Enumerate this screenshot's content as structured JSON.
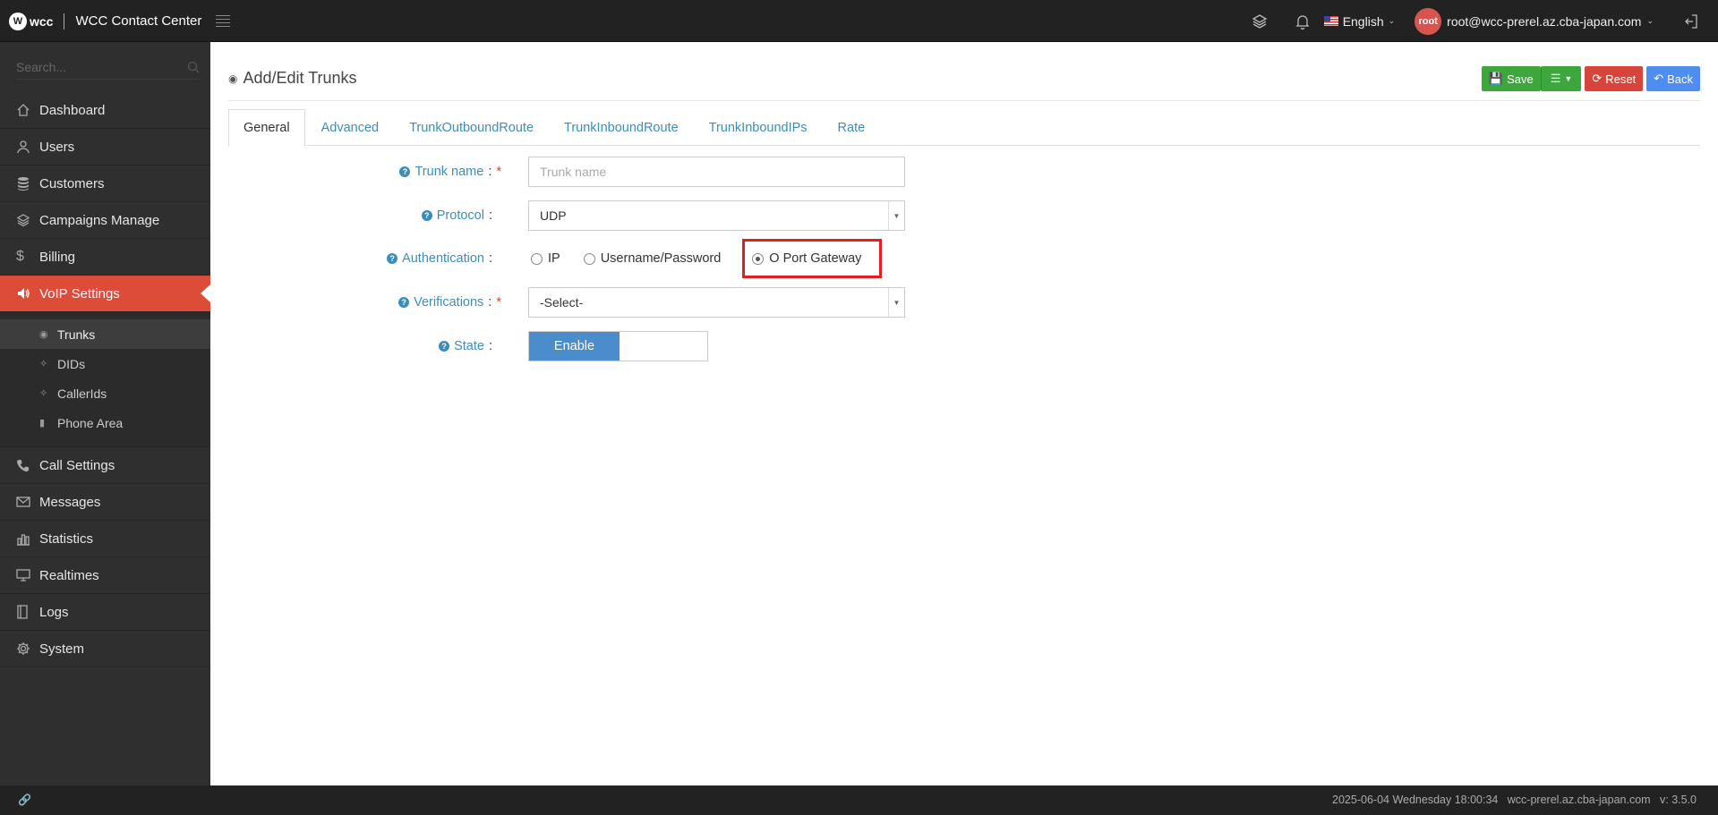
{
  "header": {
    "brand_logo": "wcc",
    "app_title": "WCC Contact Center",
    "language": "English",
    "avatar_text": "root",
    "user_email": "root@wcc-prerel.az.cba-japan.com"
  },
  "sidebar": {
    "search_placeholder": "Search...",
    "items": [
      {
        "label": "Dashboard",
        "icon": "home-icon"
      },
      {
        "label": "Users",
        "icon": "user-icon"
      },
      {
        "label": "Customers",
        "icon": "database-icon"
      },
      {
        "label": "Campaigns Manage",
        "icon": "layers-icon"
      },
      {
        "label": "Billing",
        "icon": "dollar-icon"
      },
      {
        "label": "VoIP Settings",
        "icon": "volume-icon"
      },
      {
        "label": "Call Settings",
        "icon": "phone-icon"
      },
      {
        "label": "Messages",
        "icon": "envelope-icon"
      },
      {
        "label": "Statistics",
        "icon": "bar-chart-icon"
      },
      {
        "label": "Realtimes",
        "icon": "monitor-icon"
      },
      {
        "label": "Logs",
        "icon": "book-icon"
      },
      {
        "label": "System",
        "icon": "gear-icon"
      }
    ],
    "submenu": [
      {
        "label": "Trunks",
        "icon": "dashboard-icon"
      },
      {
        "label": "DIDs",
        "icon": "crosshair-icon"
      },
      {
        "label": "CallerIds",
        "icon": "crosshair-icon"
      },
      {
        "label": "Phone Area",
        "icon": "book-icon"
      }
    ]
  },
  "page": {
    "title": "Add/Edit Trunks",
    "buttons": {
      "save": "Save",
      "reset": "Reset",
      "back": "Back"
    },
    "tabs": [
      "General",
      "Advanced",
      "TrunkOutboundRoute",
      "TrunkInboundRoute",
      "TrunkInboundIPs",
      "Rate"
    ],
    "active_tab": "General"
  },
  "form": {
    "trunk_name": {
      "label": "Trunk name",
      "placeholder": "Trunk name",
      "required": true
    },
    "protocol": {
      "label": "Protocol",
      "value": "UDP"
    },
    "authentication": {
      "label": "Authentication",
      "options": [
        "IP",
        "Username/Password",
        "O Port Gateway"
      ],
      "selected": "O Port Gateway"
    },
    "verifications": {
      "label": "Verifications",
      "value": "-Select-",
      "required": true
    },
    "state": {
      "label": "State",
      "value": "Enable"
    }
  },
  "footer": {
    "datetime": "2025-06-04 Wednesday 18:00:34",
    "host": "wcc-prerel.az.cba-japan.com",
    "version": "v: 3.5.0"
  },
  "colors": {
    "accent": "#dd4b39",
    "link": "#3c8dbc",
    "highlight": "#e0211b"
  }
}
